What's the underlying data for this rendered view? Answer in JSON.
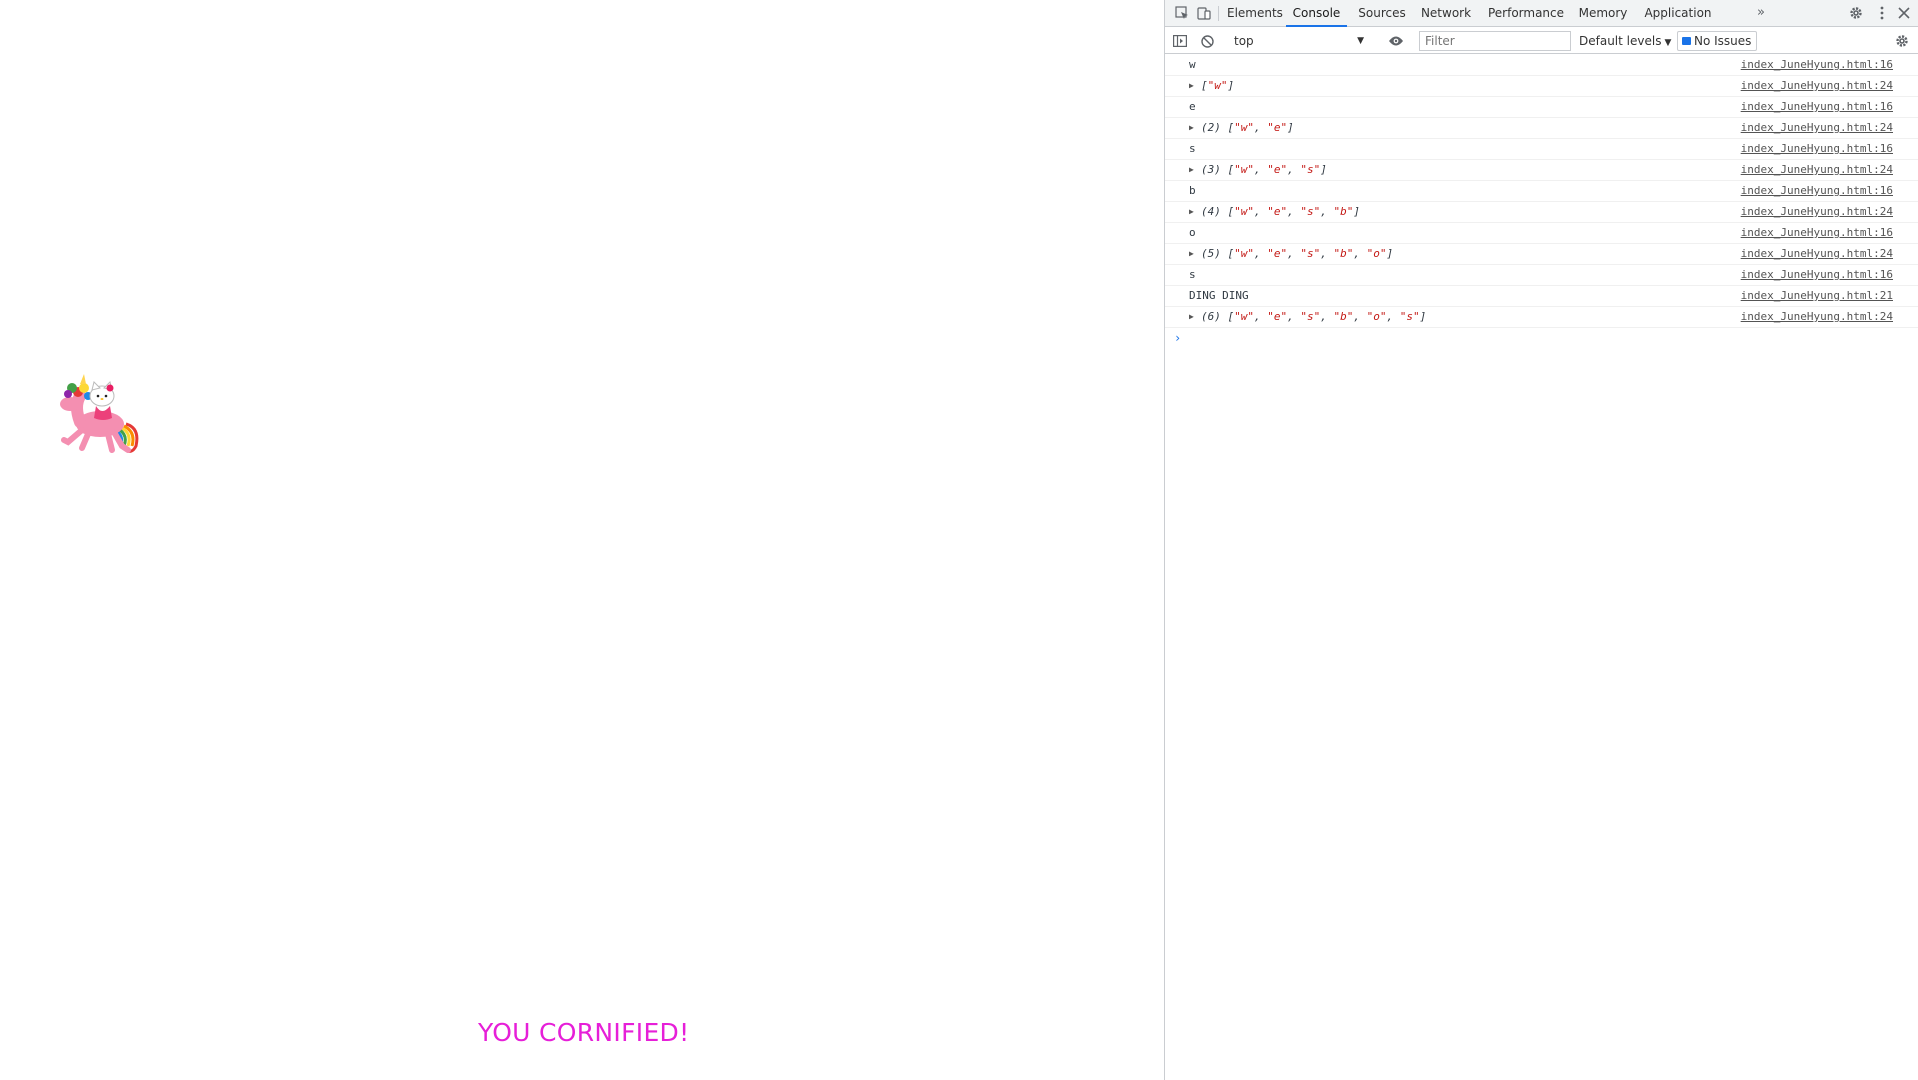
{
  "page": {
    "banner_text": "YOU CORNIFIED!",
    "banner_color": "#e61fd8",
    "image": "hello-kitty-riding-pink-unicorn"
  },
  "devtools": {
    "tabs": [
      {
        "label": "Elements",
        "active": false
      },
      {
        "label": "Console",
        "active": true
      },
      {
        "label": "Sources",
        "active": false
      },
      {
        "label": "Network",
        "active": false
      },
      {
        "label": "Performance",
        "active": false
      },
      {
        "label": "Memory",
        "active": false
      },
      {
        "label": "Application",
        "active": false
      }
    ],
    "more_tabs": "»",
    "accent": "#1a73e8",
    "toolbar": {
      "context": "top",
      "filter_placeholder": "Filter",
      "levels": "Default levels",
      "issues": "No Issues"
    },
    "console": {
      "rows": [
        {
          "kind": "text",
          "text": "w",
          "source": "index_JuneHyung.html:16"
        },
        {
          "kind": "array",
          "prefix": "",
          "items": [
            "\"w\""
          ],
          "source": "index_JuneHyung.html:24"
        },
        {
          "kind": "text",
          "text": "e",
          "source": "index_JuneHyung.html:16"
        },
        {
          "kind": "array",
          "prefix": "(2) ",
          "items": [
            "\"w\"",
            "\"e\""
          ],
          "source": "index_JuneHyung.html:24"
        },
        {
          "kind": "text",
          "text": "s",
          "source": "index_JuneHyung.html:16"
        },
        {
          "kind": "array",
          "prefix": "(3) ",
          "items": [
            "\"w\"",
            "\"e\"",
            "\"s\""
          ],
          "source": "index_JuneHyung.html:24"
        },
        {
          "kind": "text",
          "text": "b",
          "source": "index_JuneHyung.html:16"
        },
        {
          "kind": "array",
          "prefix": "(4) ",
          "items": [
            "\"w\"",
            "\"e\"",
            "\"s\"",
            "\"b\""
          ],
          "source": "index_JuneHyung.html:24"
        },
        {
          "kind": "text",
          "text": "o",
          "source": "index_JuneHyung.html:16"
        },
        {
          "kind": "array",
          "prefix": "(5) ",
          "items": [
            "\"w\"",
            "\"e\"",
            "\"s\"",
            "\"b\"",
            "\"o\""
          ],
          "source": "index_JuneHyung.html:24"
        },
        {
          "kind": "text",
          "text": "s",
          "source": "index_JuneHyung.html:16"
        },
        {
          "kind": "text",
          "text": "DING DING",
          "source": "index_JuneHyung.html:21"
        },
        {
          "kind": "array",
          "prefix": "(6) ",
          "items": [
            "\"w\"",
            "\"e\"",
            "\"s\"",
            "\"b\"",
            "\"o\"",
            "\"s\""
          ],
          "source": "index_JuneHyung.html:24"
        }
      ],
      "prompt_glyph": "›"
    }
  }
}
